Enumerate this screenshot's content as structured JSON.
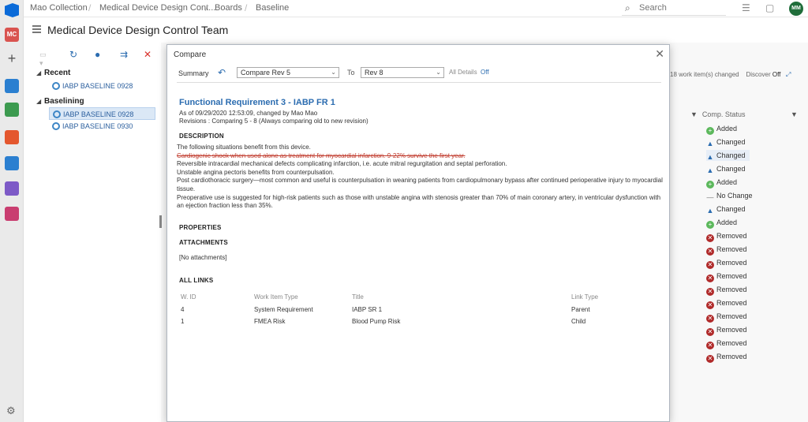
{
  "org_initials": "MC",
  "user_initials": "MM",
  "breadcrumbs": [
    "Mao Collection",
    "Medical Device Design Cont...",
    "Boards",
    "Baseline"
  ],
  "search": {
    "placeholder": "Search"
  },
  "team": {
    "title": "Medical Device Design Control Team"
  },
  "tree": {
    "recent": {
      "label": "Recent",
      "items": [
        "IABP BASELINE 0928"
      ]
    },
    "baselining": {
      "label": "Baselining",
      "items": [
        "IABP BASELINE 0928",
        "IABP BASELINE 0930"
      ]
    }
  },
  "background": {
    "changed_info": "18 work item(s) changed",
    "discover_label": "Discover",
    "discover_value": "Off",
    "comp_status_header": "Comp. Status",
    "statuses": [
      "Added",
      "Changed",
      "Changed",
      "Changed",
      "Added",
      "No Change",
      "Changed",
      "Added",
      "Removed",
      "Removed",
      "Removed",
      "Removed",
      "Removed",
      "Removed",
      "Removed",
      "Removed",
      "Removed",
      "Removed"
    ]
  },
  "modal": {
    "title": "Compare",
    "summary_label": "Summary",
    "compare_rev": "Compare Rev 5",
    "to_label": "To",
    "rev_to": "Rev 8",
    "all_details_label": "All Details",
    "all_details_value": "Off",
    "work_item_title": "Functional Requirement 3 - IABP FR 1",
    "as_of": "As of 09/29/2020 12:53:09, changed by Mao Mao",
    "revisions": "Revisions : Comparing 5 - 8 (Always comparing old to new revision)",
    "description_header": "DESCRIPTION",
    "description": {
      "line1": "The following situations benefit from this device.",
      "line2_deleted": "Cardiogenic shock when used alone as treatment for myocardial infarction. 9-22% survive the first year.",
      "line3": "Reversible intracardial mechanical defects complicating infarction, i.e. acute mitral regurgitation and septal perforation.",
      "line4": "Unstable angina pectoris benefits from counterpulsation.",
      "line5": "Post cardiothoracic surgery—most common and useful is counterpulsation in weaning patients from cardiopulmonary bypass after continued perioperative injury to myocardial tissue.",
      "line6": "Preoperative use is suggested for high-risk patients such as those with unstable angina with stenosis greater than 70% of main coronary artery, in ventricular dysfunction with an ejection fraction less than 35%."
    },
    "properties_header": "PROPERTIES",
    "attachments_header": "ATTACHMENTS",
    "no_attachments": "[No attachments]",
    "all_links_header": "ALL LINKS",
    "links_columns": [
      "W. ID",
      "Work Item Type",
      "Title",
      "Link Type"
    ],
    "links": [
      {
        "id": "4",
        "type": "System Requirement",
        "title": "IABP SR 1",
        "link_type": "Parent"
      },
      {
        "id": "1",
        "type": "FMEA Risk",
        "title": "Blood Pump Risk",
        "link_type": "Child"
      }
    ]
  }
}
